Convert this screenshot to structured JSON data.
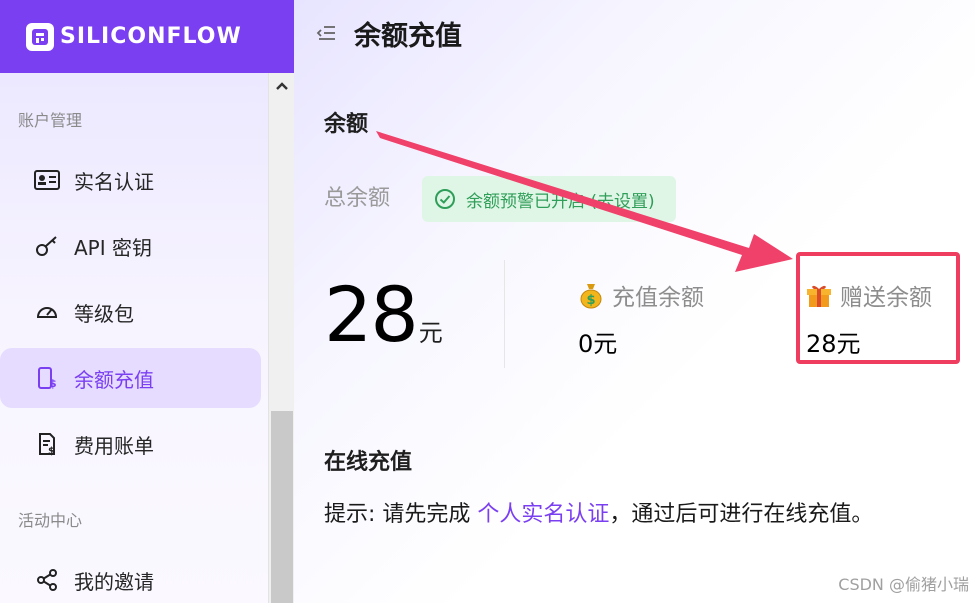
{
  "brand": {
    "name": "SILICONFLOW"
  },
  "sidebar": {
    "sections": [
      {
        "title": "账户管理"
      },
      {
        "title": "活动中心"
      }
    ],
    "items": [
      {
        "label": "实名认证",
        "icon": "id-card-icon"
      },
      {
        "label": "API 密钥",
        "icon": "key-icon"
      },
      {
        "label": "等级包",
        "icon": "gauge-icon"
      },
      {
        "label": "余额充值",
        "icon": "wallet-icon",
        "active": true
      },
      {
        "label": "费用账单",
        "icon": "bill-icon"
      },
      {
        "label": "我的邀请",
        "icon": "share-icon"
      }
    ]
  },
  "header": {
    "title": "余额充值"
  },
  "balance": {
    "heading": "余额",
    "total_label": "总余额",
    "alert_text": "余额预警已开启 (去设置)",
    "total_value": "28",
    "total_unit": "元",
    "recharge_label": "充值余额",
    "recharge_value": "0元",
    "gift_label": "赠送余额",
    "gift_value": "28元"
  },
  "online": {
    "heading": "在线充值",
    "tip_prefix": "提示: 请先完成 ",
    "tip_link": "个人实名认证",
    "tip_suffix": "，通过后可进行在线充值。"
  },
  "watermark": "CSDN @偷猪小瑞",
  "colors": {
    "brand": "#7b3ff2",
    "active_bg": "#e6dcff",
    "alert_bg": "#dff6e6",
    "alert_text": "#2f9e58",
    "highlight": "#ee3d5e"
  }
}
